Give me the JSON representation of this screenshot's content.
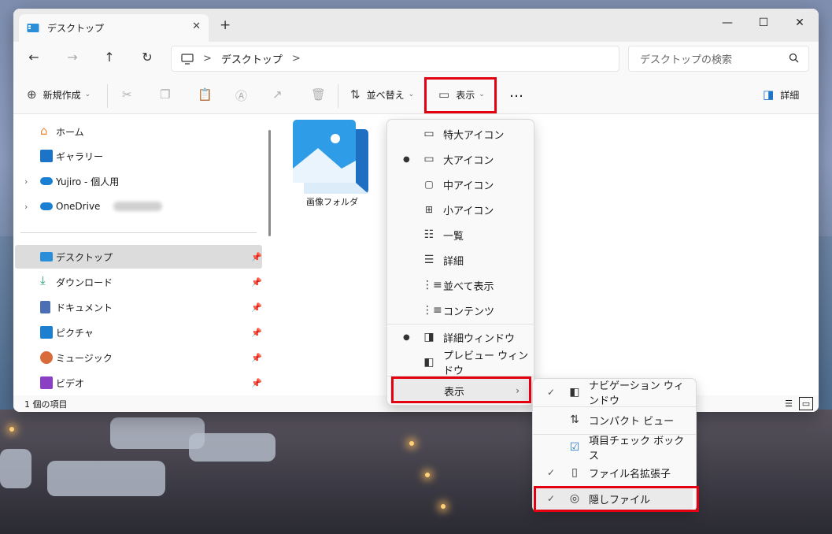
{
  "window": {
    "tab_title": "デスクトップ",
    "new_tab": "+",
    "minimize": "—",
    "maximize": "☐",
    "close": "✕"
  },
  "nav": {
    "back": "←",
    "forward": "→",
    "up": "↑",
    "refresh": "↻",
    "breadcrumb": [
      "デスクトップ"
    ],
    "breadcrumb_sep": ">",
    "search_placeholder": "デスクトップの検索"
  },
  "toolbar": {
    "new_label": "新規作成",
    "sort_label": "並べ替え",
    "view_label": "表示",
    "more_label": "…",
    "details_label": "詳細"
  },
  "sidebar": {
    "items": [
      {
        "label": "ホーム",
        "icon": "home-icon",
        "color": "#e8893a"
      },
      {
        "label": "ギャラリー",
        "icon": "gallery-icon",
        "color": "#1b74c7"
      },
      {
        "label": "Yujiro - 個人用",
        "icon": "cloud-icon",
        "color": "#1b7fd4"
      },
      {
        "label": "OneDrive",
        "icon": "cloud-icon",
        "color": "#1b7fd4"
      },
      {
        "label": "デスクトップ",
        "icon": "desktop-icon",
        "color": "#2a8fd8"
      },
      {
        "label": "ダウンロード",
        "icon": "download-icon",
        "color": "#1a9a6b"
      },
      {
        "label": "ドキュメント",
        "icon": "document-icon",
        "color": "#4a6fb5"
      },
      {
        "label": "ピクチャ",
        "icon": "pictures-icon",
        "color": "#1d7fd0"
      },
      {
        "label": "ミュージック",
        "icon": "music-icon",
        "color": "#d96a3a"
      },
      {
        "label": "ビデオ",
        "icon": "video-icon",
        "color": "#8a3fc4"
      }
    ]
  },
  "files": [
    {
      "name": "画像フォルダ"
    }
  ],
  "status": {
    "count": "1 個の項目"
  },
  "view_menu": {
    "items": [
      {
        "label": "特大アイコン"
      },
      {
        "label": "大アイコン"
      },
      {
        "label": "中アイコン"
      },
      {
        "label": "小アイコン"
      },
      {
        "label": "一覧"
      },
      {
        "label": "詳細"
      },
      {
        "label": "並べて表示"
      },
      {
        "label": "コンテンツ"
      },
      {
        "label": "詳細ウィンドウ"
      },
      {
        "label": "プレビュー ウィンドウ"
      },
      {
        "label": "表示"
      }
    ]
  },
  "show_menu": {
    "items": [
      {
        "label": "ナビゲーション ウィンドウ"
      },
      {
        "label": "コンパクト ビュー"
      },
      {
        "label": "項目チェック ボックス"
      },
      {
        "label": "ファイル名拡張子"
      },
      {
        "label": "隠しファイル"
      }
    ]
  },
  "accent_color": "#e30010"
}
